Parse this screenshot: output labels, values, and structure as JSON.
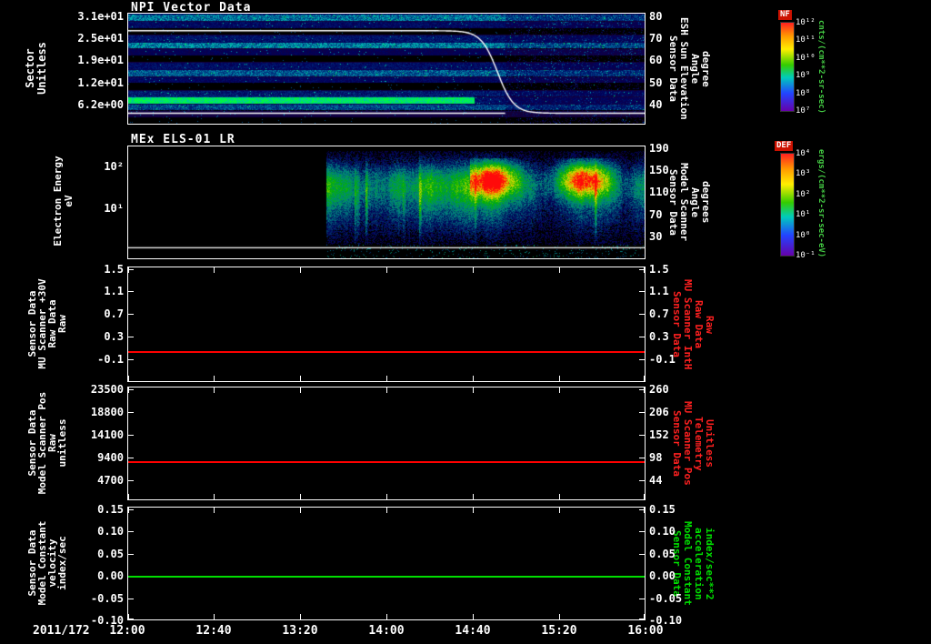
{
  "colors": {
    "background": "#000000",
    "axis": "#ffffff",
    "trace_red": "#ff0000",
    "trace_green": "#00e000",
    "right_label_red": "#ff2020",
    "right_label_green": "#00e000",
    "colorbar_unit_green": "#44cc44"
  },
  "xaxis": {
    "date": "2011/172",
    "ticks": [
      "12:00",
      "12:40",
      "13:20",
      "14:00",
      "14:40",
      "15:20",
      "16:00"
    ]
  },
  "panels": {
    "npi": {
      "title": "NPI Vector Data",
      "left_axis": {
        "label": "Sector\nUnitless",
        "ticks": [
          "3.1e+01",
          "2.5e+01",
          "1.9e+01",
          "1.2e+01",
          "6.2e+00"
        ]
      },
      "right_axis": {
        "label": "Sensor Data\nESH Sun Elevation\nAngle\ndegree",
        "ticks": [
          "80",
          "70",
          "60",
          "50",
          "40"
        ]
      },
      "colorbar": {
        "title": "NF",
        "unit": "cnts/(cm**2-sr-sec)",
        "ticks": [
          "10¹²",
          "10¹¹",
          "10¹⁰",
          "10⁹",
          "10⁸",
          "10⁷"
        ]
      }
    },
    "els": {
      "title": "MEx ELS-01 LR",
      "left_axis": {
        "label": "Electron Energy\neV",
        "ticks": [
          "10²",
          "10¹"
        ]
      },
      "right_axis": {
        "label": "Sensor Data\nModel Scanner\nAngle\ndegrees",
        "ticks": [
          "190",
          "150",
          "110",
          "70",
          "30"
        ]
      },
      "colorbar": {
        "title": "DEF",
        "unit": "ergs/(cm**2-sr-sec-eV)",
        "ticks": [
          "10⁴",
          "10³",
          "10²",
          "10¹",
          "10⁰",
          "10⁻¹"
        ]
      }
    },
    "p3": {
      "left_axis": {
        "label": "Sensor Data\nMU Scanner +30V\nRaw Data\nRaw",
        "ticks": [
          "1.5",
          "1.1",
          "0.7",
          "0.3",
          "-0.1"
        ]
      },
      "right_axis": {
        "label": "Sensor Data\nMU Scanner IntH\nRaw Data\nRaw",
        "ticks": [
          "1.5",
          "1.1",
          "0.7",
          "0.3",
          "-0.1"
        ]
      }
    },
    "p4": {
      "left_axis": {
        "label": "Sensor Data\nModel Scanner Pos\nRaw\nunitless",
        "ticks": [
          "23500",
          "18800",
          "14100",
          "9400",
          "4700"
        ]
      },
      "right_axis": {
        "label": "Sensor Data\nMU Scanner Pos\nTelemetry\nUnitless",
        "ticks": [
          "260",
          "206",
          "152",
          "98",
          "44"
        ]
      }
    },
    "p5": {
      "left_axis": {
        "label": "Sensor Data\nModel Constant\nvelocity\nindex/sec",
        "ticks": [
          "0.15",
          "0.10",
          "0.05",
          "0.00",
          "-0.05",
          "-0.10"
        ]
      },
      "right_axis": {
        "label": "Sensor Data\nModel Constant\nacceleration\nindex/sec**2",
        "ticks": [
          "0.15",
          "0.10",
          "0.05",
          "0.00",
          "-0.05",
          "-0.10"
        ]
      }
    }
  },
  "chart_data": [
    {
      "type": "heatmap",
      "title": "NPI Vector Data",
      "ylabel": "Sector (Unitless)",
      "yticks": [
        "3.1e+01",
        "2.5e+01",
        "1.9e+01",
        "1.2e+01",
        "6.2e+00"
      ],
      "xlim": [
        "2011/172 12:00",
        "2011/172 16:00"
      ],
      "xticks": [
        "12:00",
        "12:40",
        "13:20",
        "14:00",
        "14:40",
        "15:20",
        "16:00"
      ],
      "zlabel": "NF cnts/(cm**2-sr-sec)",
      "description": "Horizontal sector bands of low-level blue/purple counts separated by black gaps; brighter cyan-blue band near sectors 5-8 until ~15:00; noisier speckled counts after ~15:00.",
      "overlay_line": {
        "name": "ESH Sun Elevation Angle (degree, right axis)",
        "x": [
          "12:00",
          "13:00",
          "14:00",
          "14:30",
          "14:45",
          "15:00",
          "15:10",
          "16:00"
        ],
        "y": [
          70,
          70,
          70,
          69,
          62,
          45,
          39,
          38
        ]
      }
    },
    {
      "type": "heatmap",
      "title": "MEx ELS-01 LR",
      "ylabel": "Electron Energy (eV)",
      "yscale": "log",
      "yticks": [
        "10²",
        "10¹"
      ],
      "right_axis": {
        "label": "Model Scanner Angle (degrees)",
        "ticks": [
          190,
          150,
          110,
          70,
          30
        ]
      },
      "zlabel": "DEF ergs/(cm**2-sr-sec-eV)",
      "data_gap": "No data from 12:00 until ~13:32",
      "description": "Broadband electron spectra ~5-150 eV beginning ~13:32; moderate green/yellow flux with intense red enhancements at 20-100 eV between ~14:40 and ~15:45; weak blue flux at lower energies; thin white constant trace near bottom."
    },
    {
      "type": "line",
      "name": "Sensor Data MU Scanner +30V Raw Data Raw",
      "color": "#ff0000",
      "yticks": [
        1.5,
        1.1,
        0.7,
        0.3,
        -0.1
      ],
      "value_constant": 0.0
    },
    {
      "type": "line",
      "name": "Sensor Data Model Scanner Pos Raw (unitless)",
      "color": "#ff0000",
      "yticks": [
        23500,
        18800,
        14100,
        9400,
        4700
      ],
      "right_yticks": [
        260,
        206,
        152,
        98,
        44
      ],
      "value_constant": 8650
    },
    {
      "type": "line",
      "name": "Sensor Data Model Constant velocity (index/sec)",
      "color": "#00e000",
      "yticks": [
        0.15,
        0.1,
        0.05,
        0.0,
        -0.05,
        -0.1
      ],
      "value_constant": 0.0
    }
  ]
}
